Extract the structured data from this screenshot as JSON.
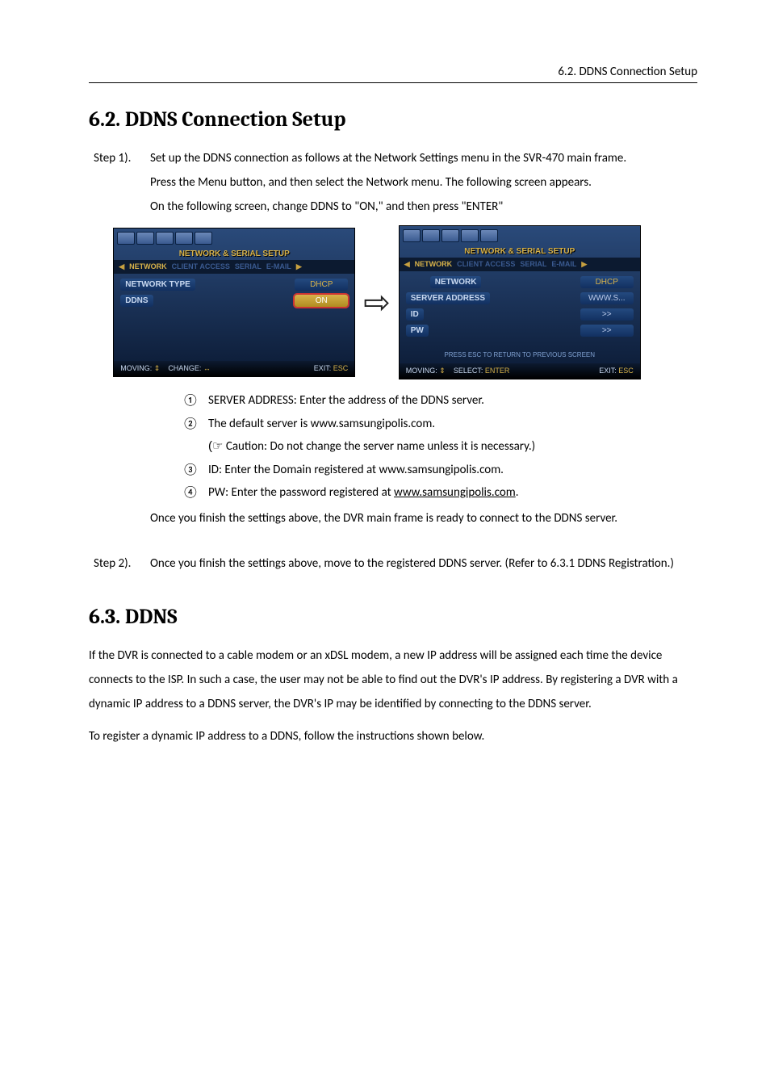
{
  "header": {
    "running": "6.2. DDNS Connection Setup"
  },
  "section62": {
    "heading": "6.2. DDNS Connection Setup",
    "step1": {
      "label": "Step 1).",
      "line1": "Set up the DDNS connection as follows at the Network Settings menu in the SVR-470 main frame.",
      "line2": "Press the Menu button, and then select the Network menu. The following screen appears.",
      "line3": "On the following screen, change DDNS to \"ON,\" and then press \"ENTER\""
    },
    "figA": {
      "title": "NETWORK & SERIAL SETUP",
      "tabs": [
        "NETWORK",
        "CLIENT ACCESS",
        "SERIAL",
        "E-MAIL"
      ],
      "active_tab": 0,
      "row1_lbl": "NETWORK TYPE",
      "row1_val": "DHCP",
      "row2_lbl": "DDNS",
      "row2_val": "ON",
      "foot_moving": "MOVING:",
      "foot_change": "CHANGE:",
      "foot_exit": "EXIT:",
      "foot_esc": "ESC",
      "sym_ud": "⇕",
      "sym_lr": "↔"
    },
    "figB": {
      "title": "NETWORK & SERIAL SETUP",
      "tabs": [
        "NETWORK",
        "CLIENT ACCESS",
        "SERIAL",
        "E-MAIL"
      ],
      "active_tab": 0,
      "row1_lbl": "NETWORK",
      "row1_val": "DHCP",
      "row2_lbl": "SERVER ADDRESS",
      "row2_val": "WWW.S...",
      "row3_lbl": "ID",
      "row3_val": ">>",
      "row4_lbl": "PW",
      "row4_val": ">>",
      "note": "PRESS ESC TO RETURN TO PREVIOUS SCREEN",
      "foot_moving": "MOVING:",
      "foot_select": "SELECT:",
      "foot_enter": "ENTER",
      "foot_exit": "EXIT:",
      "foot_esc": "ESC",
      "sym_ud": "⇕"
    },
    "list": {
      "n1": "①",
      "t1": "SERVER ADDRESS: Enter the address of the DDNS server.",
      "n2": "②",
      "t2": "The default server is www.samsungipolis.com.",
      "caution_sym": "(☞",
      "caution": " Caution: Do not change the server name unless it is necessary.)",
      "n3": "③",
      "t3": "ID: Enter the Domain registered at www.samsungipolis.com.",
      "n4": "④",
      "t4_pre": "PW: Enter the password registered at ",
      "t4_link": "www.samsungipolis.com",
      "t4_post": "."
    },
    "after_list": "Once you finish the settings above, the DVR main frame is ready to connect to the DDNS server.",
    "step2": {
      "label": "Step 2).",
      "text": "Once you finish the settings above, move to the registered DDNS server. (Refer to 6.3.1 DDNS Registration.)"
    }
  },
  "section63": {
    "heading": "6.3. DDNS",
    "p1": "If the DVR is connected to a cable modem or an xDSL modem, a new IP address will be assigned each time the device connects to the ISP. In such a case, the user may not be able to find out the DVR's IP address. By registering a DVR with a dynamic IP address to a DDNS server, the DVR's IP may be identified by connecting to the DDNS server.",
    "p2": "To register a dynamic IP address to a DDNS, follow the instructions shown below."
  }
}
